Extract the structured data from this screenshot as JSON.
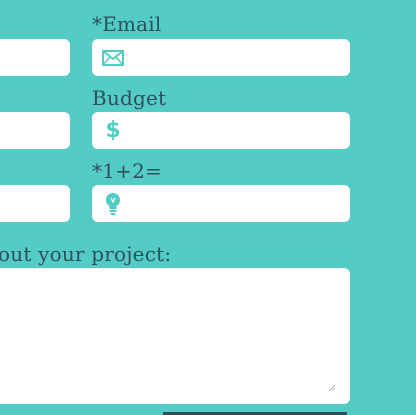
{
  "form": {
    "email": {
      "label": "*Email",
      "value": "",
      "icon": "envelope-icon"
    },
    "budget": {
      "label": "Budget",
      "value": "",
      "icon": "dollar-icon",
      "symbol": "$"
    },
    "captcha": {
      "label": "*1+2=",
      "value": "",
      "icon": "lightbulb-icon"
    },
    "project": {
      "label": "out your project:",
      "value": ""
    },
    "left_inputs": [
      {
        "value": ""
      },
      {
        "value": ""
      },
      {
        "value": ""
      }
    ]
  },
  "colors": {
    "background": "#52CCC4",
    "text": "#2E4F5B",
    "field": "#FFFFFF",
    "icon": "#52CCC4"
  }
}
